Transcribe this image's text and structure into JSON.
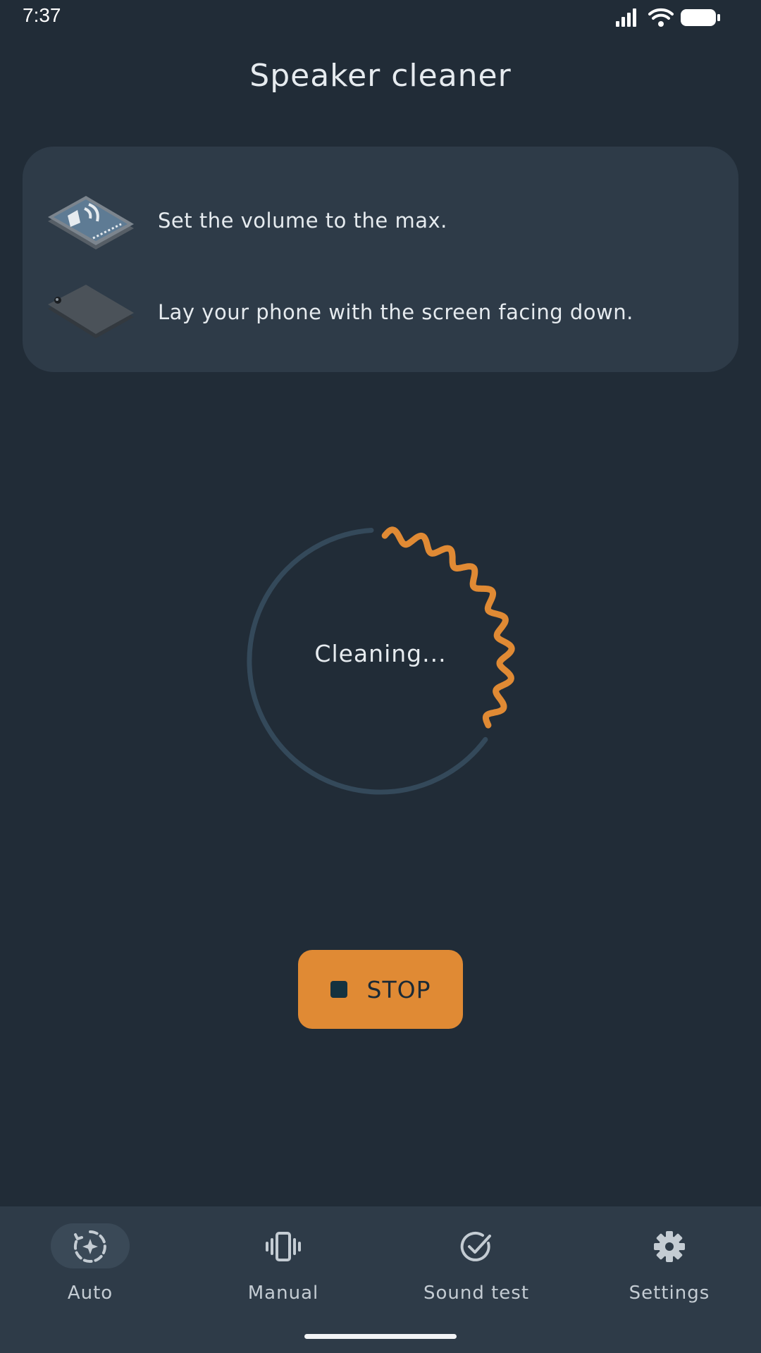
{
  "status_bar": {
    "time": "7:37"
  },
  "header": {
    "title": "Speaker cleaner"
  },
  "instructions": [
    {
      "icon": "phone-speaker-icon",
      "text": "Set the volume to the max."
    },
    {
      "icon": "phone-face-down-icon",
      "text": "Lay your phone with the screen facing down."
    }
  ],
  "progress": {
    "label": "Cleaning...",
    "fraction": 0.33
  },
  "stop_button": {
    "label": "STOP"
  },
  "nav": {
    "items": [
      {
        "label": "Auto",
        "icon": "auto-clean-icon",
        "active": true
      },
      {
        "label": "Manual",
        "icon": "vibrate-icon",
        "active": false
      },
      {
        "label": "Sound test",
        "icon": "check-circle-icon",
        "active": false
      },
      {
        "label": "Settings",
        "icon": "gear-icon",
        "active": false
      }
    ]
  },
  "colors": {
    "background": "#212c37",
    "card": "#2e3b48",
    "accent": "#e08a34",
    "track": "#34495a"
  }
}
